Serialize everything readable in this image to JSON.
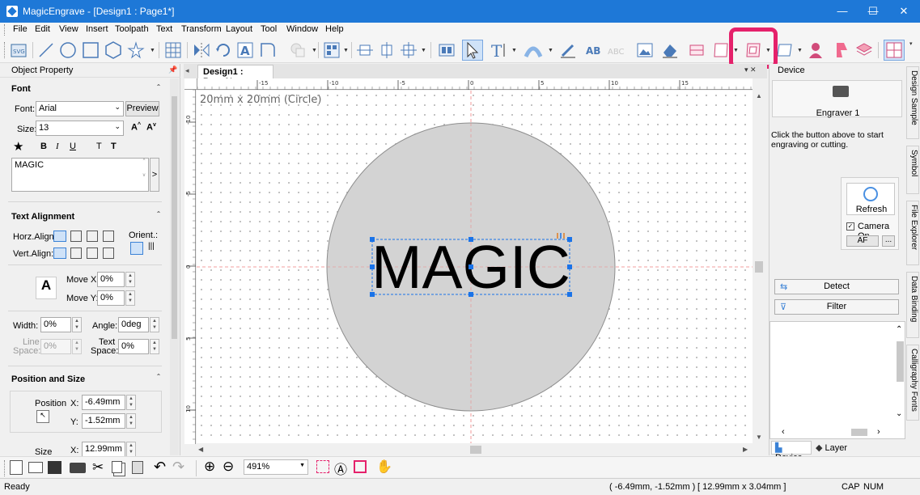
{
  "window": {
    "title": "MagicEngrave - [Design1 : Page1*]",
    "controls": {
      "minimize": "—",
      "maximize": "☐",
      "close": "✕"
    }
  },
  "menu": [
    "File",
    "Edit",
    "View",
    "Insert",
    "Toolpath",
    "Text",
    "Transform",
    "Layout",
    "Tool",
    "Window",
    "Help"
  ],
  "object_property": {
    "header": "Object Property",
    "font_section": {
      "title": "Font",
      "font_label": "Font:",
      "font_value": "Arial",
      "preview_button": "Preview",
      "size_label": "Size:",
      "size_value": "13",
      "text_value": "MAGIC",
      "expand_glyph": ">"
    },
    "alignment_section": {
      "title": "Text Alignment",
      "horz_label": "Horz.Align:",
      "vert_label": "Vert.Align:",
      "orient_label": "Orient.:",
      "move_x_label": "Move X:",
      "move_x_value": "0%",
      "move_y_label": "Move Y:",
      "move_y_value": "0%",
      "width_label": "Width:",
      "width_value": "0%",
      "angle_label": "Angle:",
      "angle_value": "0deg",
      "line_space_label_1": "Line",
      "line_space_label_2": "Space:",
      "line_space_value": "0%",
      "text_space_label_1": "Text",
      "text_space_label_2": "Space:",
      "text_space_value": "0%"
    },
    "position_section": {
      "title": "Position and Size",
      "position_label": "Position",
      "x_label": "X:",
      "x_value": "-6.49mm",
      "y_label": "Y:",
      "y_value": "-1.52mm",
      "size_label": "Size",
      "size_x_label": "X:",
      "size_x_value": "12.99mm"
    }
  },
  "document": {
    "tab_label": "Design1 : Page1*",
    "shape_caption": "20mm x 20mm (Circle)",
    "text": "MAGIC",
    "ruler_h": [
      "-15",
      "-10",
      "-5",
      "0",
      "5",
      "10",
      "15"
    ],
    "ruler_v": [
      "-10",
      "-5",
      "0",
      "5",
      "10"
    ]
  },
  "device_panel": {
    "header": "Device",
    "engraver_label": "Engraver 1",
    "instructions": "Click the button above to start engraving or cutting.",
    "refresh_button": "Refresh",
    "camera_on_label": "Camera On",
    "af_button": "AF",
    "more_button": "...",
    "detect_button": "Detect",
    "filter_button": "Filter",
    "bottom_tabs": [
      "Device",
      "Layer"
    ]
  },
  "side_tabs": [
    "Design Sample",
    "Symbol",
    "File Explorer",
    "Data Binding",
    "Calligraphy Fonts"
  ],
  "zoom": {
    "value": "491%"
  },
  "status": {
    "left": "Ready",
    "coords": "( -6.49mm, -1.52mm )",
    "size": "[ 12.99mm x 3.04mm ]",
    "cap": "CAP",
    "num": "NUM"
  },
  "colors": {
    "titlebar": "#1e78d7",
    "highlight": "#e5216b",
    "selection": "#1a73e8",
    "circle_fill": "#d3d3d3"
  }
}
